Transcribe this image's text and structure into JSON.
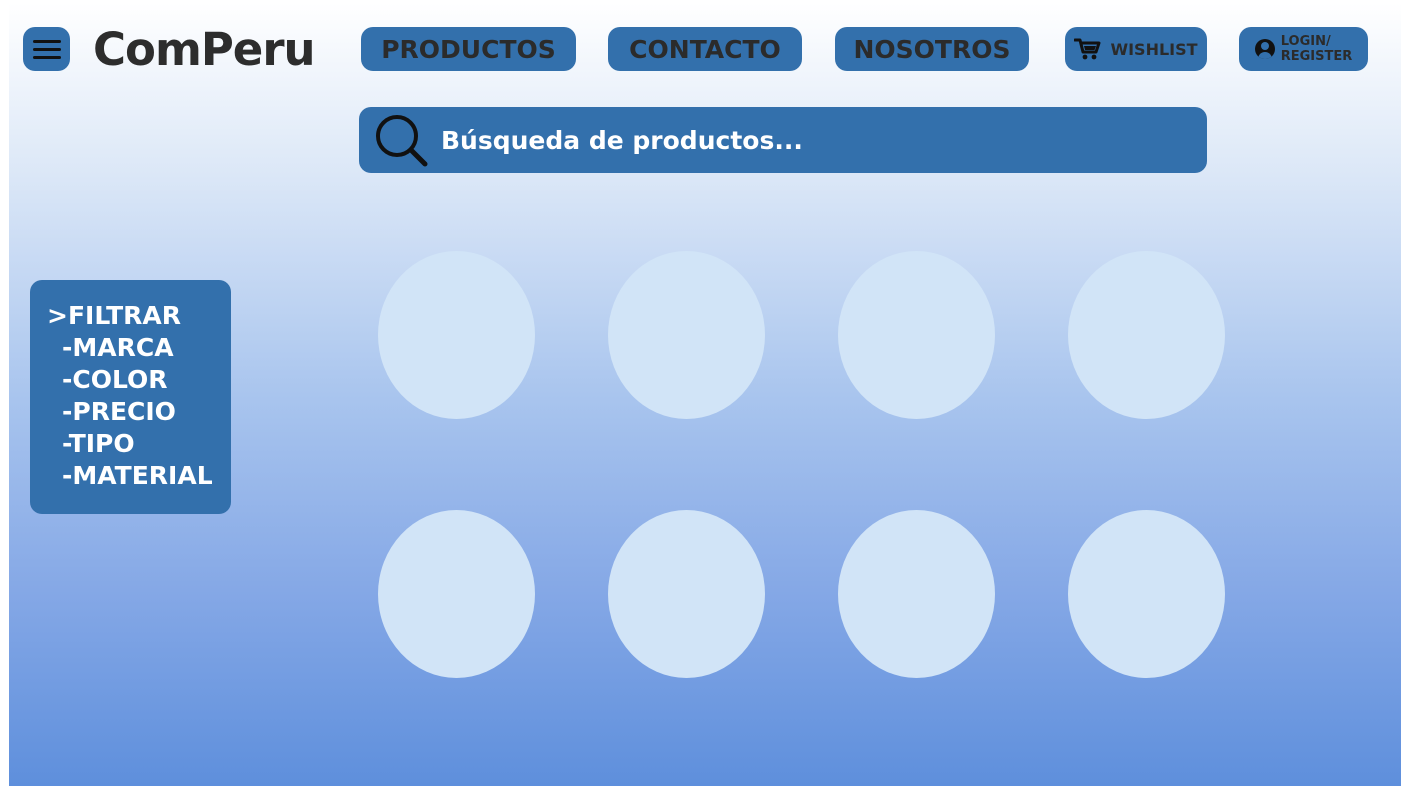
{
  "header": {
    "logo": "ComPeru",
    "nav": {
      "productos": "PRODUCTOS",
      "contacto": "CONTACTO",
      "nosotros": "NOSOTROS"
    },
    "wishlist": "WISHLIST",
    "login_line1": "LOGIN/",
    "login_line2": "REGISTER",
    "menu_icon": "hamburger-menu-icon",
    "wishlist_icon": "cart-icon",
    "login_icon": "user-icon"
  },
  "search": {
    "placeholder": "Búsqueda de productos...",
    "icon": "search-icon"
  },
  "filter": {
    "title": ">FILTRAR",
    "options": [
      "-MARCA",
      "-COLOR",
      "-PRECIO",
      "-TIPO",
      "-MATERIAL"
    ]
  },
  "colors": {
    "accent": "#3370ac",
    "product_placeholder": "#d1e4f7",
    "background_top": "#ffffff",
    "background_bottom": "#5e8fdc"
  }
}
